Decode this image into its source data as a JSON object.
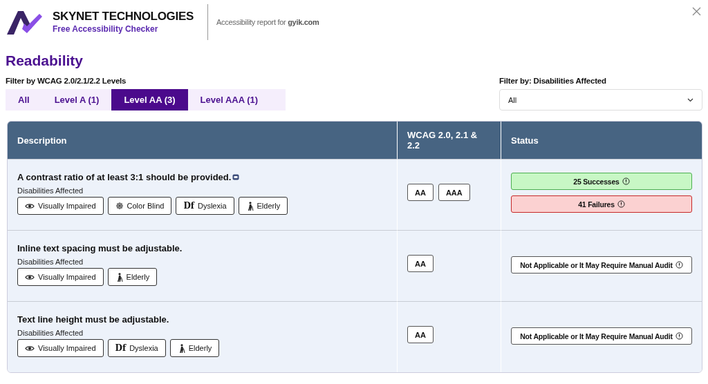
{
  "brand": {
    "name": "SKYNET TECHNOLOGIES",
    "tagline": "Free Accessibility Checker"
  },
  "report": {
    "prefix": "Accessibility report for ",
    "site": "gyik.com"
  },
  "section_title": "Readability",
  "level_filter": {
    "label": "Filter by WCAG 2.0/2.1/2.2 Levels",
    "tabs": [
      {
        "label": "All",
        "selected": false
      },
      {
        "label": "Level A (1)",
        "selected": false
      },
      {
        "label": "Level AA (3)",
        "selected": true
      },
      {
        "label": "Level AAA (1)",
        "selected": false
      }
    ]
  },
  "disability_filter": {
    "label": "Filter by: Disabilities Affected",
    "value": "All"
  },
  "table": {
    "columns": [
      "Description",
      "WCAG 2.0, 2.1 & 2.2",
      "Status"
    ],
    "rows": [
      {
        "description": "A contrast ratio of at least 3:1 should be provided.",
        "has_note_icon": true,
        "disabilities_label": "Disabilities Affected",
        "tags": [
          {
            "kind": "visual",
            "label": "Visually Impaired"
          },
          {
            "kind": "colorblind",
            "label": "Color Blind"
          },
          {
            "kind": "dyslexia",
            "glyph": "Df",
            "label": "Dyslexia"
          },
          {
            "kind": "elderly",
            "label": "Elderly"
          }
        ],
        "levels": [
          "AA",
          "AAA"
        ],
        "status": [
          {
            "kind": "success",
            "label": "25 Successes"
          },
          {
            "kind": "failure",
            "label": "41 Failures"
          }
        ]
      },
      {
        "description": "Inline text spacing must be adjustable.",
        "has_note_icon": false,
        "disabilities_label": "Disabilities Affected",
        "tags": [
          {
            "kind": "visual",
            "label": "Visually Impaired"
          },
          {
            "kind": "elderly",
            "label": "Elderly"
          }
        ],
        "levels": [
          "AA"
        ],
        "status": [
          {
            "kind": "manual",
            "label": "Not Applicable or It May Require Manual Audit"
          }
        ]
      },
      {
        "description": "Text line height must be adjustable.",
        "has_note_icon": false,
        "disabilities_label": "Disabilities Affected",
        "tags": [
          {
            "kind": "visual",
            "label": "Visually Impaired"
          },
          {
            "kind": "dyslexia",
            "glyph": "Df",
            "label": "Dyslexia"
          },
          {
            "kind": "elderly",
            "label": "Elderly"
          }
        ],
        "levels": [
          "AA"
        ],
        "status": [
          {
            "kind": "manual",
            "label": "Not Applicable or It May Require Manual Audit"
          }
        ]
      }
    ]
  }
}
